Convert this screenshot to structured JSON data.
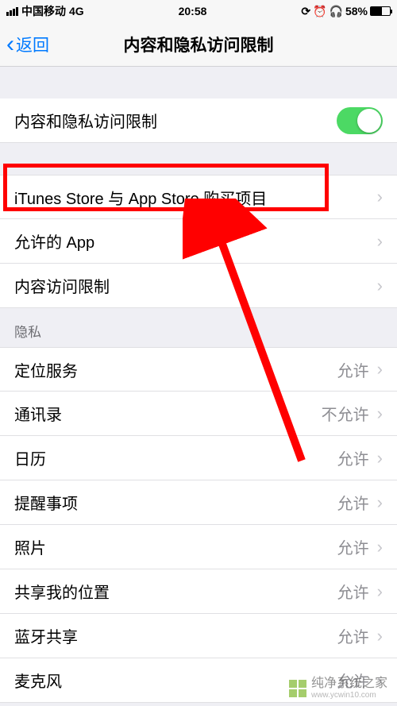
{
  "status": {
    "carrier": "中国移动",
    "network": "4G",
    "time": "20:58",
    "battery_pct": "58%"
  },
  "nav": {
    "back": "返回",
    "title": "内容和隐私访问限制"
  },
  "rows": {
    "toggle": {
      "label": "内容和隐私访问限制",
      "on": true
    },
    "itunes": {
      "label": "iTunes Store 与 App Store 购买项目"
    },
    "allowed_apps": {
      "label": "允许的 App"
    },
    "content_restrictions": {
      "label": "内容访问限制"
    }
  },
  "privacy": {
    "header": "隐私",
    "items": [
      {
        "label": "定位服务",
        "value": "允许"
      },
      {
        "label": "通讯录",
        "value": "不允许"
      },
      {
        "label": "日历",
        "value": "允许"
      },
      {
        "label": "提醒事项",
        "value": "允许"
      },
      {
        "label": "照片",
        "value": "允许"
      },
      {
        "label": "共享我的位置",
        "value": "允许"
      },
      {
        "label": "蓝牙共享",
        "value": "允许"
      },
      {
        "label": "麦克风",
        "value": "允许"
      }
    ]
  },
  "watermark": {
    "text": "纯净系统之家",
    "url": "www.ycwin10.com"
  }
}
